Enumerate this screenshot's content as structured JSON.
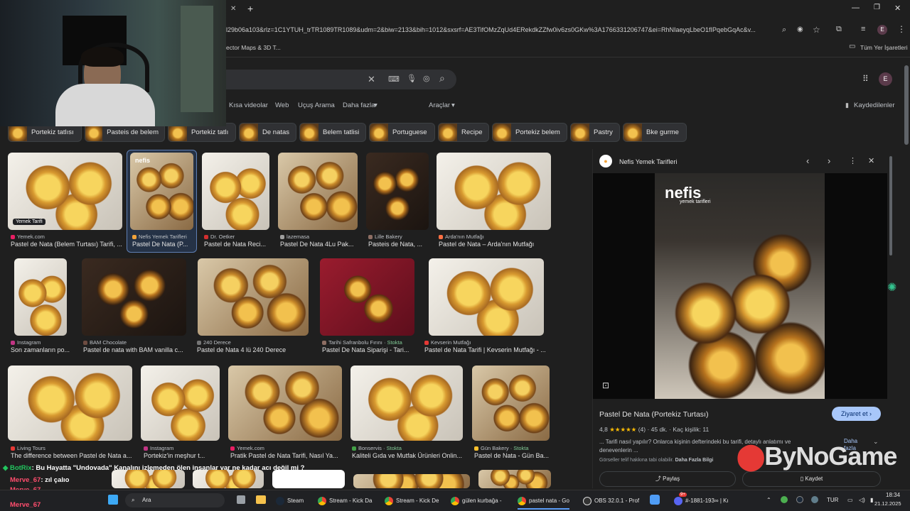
{
  "browser": {
    "url": "l29b06a103&rlz=1C1YTUH_trTR1089TR1089&udm=2&biw=2133&bih=1012&sxsrf=AE3TifOMzZqUd4ERekdkZZfw0iv6zs0GKw%3A1766331206747&ei=RhNIaeyqLbeO1fIPqebGqAc&v...",
    "bookmark_left": "ector Maps & 3D T...",
    "bookmark_right": "Tüm Yer İşaretleri",
    "profile_initial": "E"
  },
  "search": {
    "nav_tabs": [
      "Kısa videolar",
      "Web",
      "Uçuş Arama",
      "Daha fazla"
    ],
    "tools": "Araçlar",
    "saved": "Kaydedilenler",
    "chips": [
      "Portekiz tatlısı",
      "Pasteis de belem",
      "Portekiz tatlı",
      "De natas",
      "Belem tatlisi",
      "Portuguese",
      "Recipe",
      "Portekiz belem",
      "Pastry",
      "Bke gurme"
    ]
  },
  "results": {
    "row1": [
      {
        "source": "Yemek.com",
        "title": "Pastel de Nata (Belem Turtası) Tarifi, ...",
        "badge": "Yemek Tarifi"
      },
      {
        "source": "Nefis Yemek Tarifleri",
        "title": "Pastel De Nata (P..."
      },
      {
        "source": "Dr. Oetker",
        "title": "Pastel de Nata Reci..."
      },
      {
        "source": "lazemasa",
        "title": "Pastel De Nata 4Lu Pak..."
      },
      {
        "source": "Lille Bakery",
        "title": "Pasteis de Nata, ..."
      },
      {
        "source": "Arda'nın Mutfağı",
        "title": "Pastel de Nata – Arda'nın Mutfağı"
      }
    ],
    "row2": [
      {
        "source": "Instagram",
        "title": "Son zamanların po..."
      },
      {
        "source": "BAM Chocolate",
        "title": "Pastel de nata with BAM vanilla c..."
      },
      {
        "source": "240 Derece",
        "title": "Pastel de Nata 4 lü 240 Derece"
      },
      {
        "source": "Tarihi Safranbolu Fırını",
        "stock": "Stokta",
        "title": "Pastel De Nata Siparişi - Tari..."
      },
      {
        "source": "Kevserin Mutfağı",
        "title": "Pastel de Nata Tarifi | Kevserin Mutfağı - ..."
      }
    ],
    "row3": [
      {
        "source": "Living Tours",
        "title": "The difference between Pastel de Nata a..."
      },
      {
        "source": "Instagram",
        "title": "Portekiz'in meşhur t..."
      },
      {
        "source": "Yemek.com",
        "title": "Pratik Pastel de Nata Tarifi, Nasıl Ya..."
      },
      {
        "source": "Bonservis",
        "stock": "Stokta",
        "title": "Kaliteli Gıda ve Mutfak Ürünleri Onlin..."
      },
      {
        "source": "Gün Bakery",
        "stock": "Stokta",
        "title": "Pastel de Nata - Gün Ba..."
      }
    ]
  },
  "panel": {
    "site": "Nefis Yemek Tarifleri",
    "watermark": "nefis",
    "watermark_sub": "yemek tarifleri",
    "title": "Pastel De Nata (Portekiz Turtası)",
    "visit": "Ziyaret et",
    "rating": "4,8",
    "stars": "★★★★★",
    "reviews": "(4)",
    "time": "45 dk.",
    "servings": "Kaç kişilik: 11",
    "desc": "... Tarifi nasıl yapılır? Onlarca kişinin defterindeki bu tarifi, detaylı anlatımı ve denevenlerin ...",
    "more": "Daha fazla",
    "copyright": "Görseller telif hakkına tabi olabilir.",
    "more_info": "Daha Fazla Bilgi",
    "share": "Paylaş",
    "save": "Kaydet"
  },
  "chat": [
    {
      "user": "BotRix",
      "msg": ": Bu Hayatta \"Undovada\" Kanalını izlemeden ölen insanlar var ne kadar acı değil mi ?"
    },
    {
      "user": "Merve_67",
      "msg": ": zıl çalıo"
    },
    {
      "user": "Merve_67",
      "msg": ""
    },
    {
      "user": "Merve_67",
      "msg": ""
    }
  ],
  "overlay_logo": "ByNoGame",
  "taskbar": {
    "search": "Ara",
    "items": [
      "Steam",
      "Stream - Kick Da",
      "Stream - Kick De",
      "gülen kurbağa -",
      "pastel nata - Go",
      "OBS 32.0.1 - Prof",
      "#-1881-193∞ | Kı"
    ],
    "lang": "TUR",
    "time": "18:34",
    "date": "21.12.2025",
    "badge": "9+"
  }
}
